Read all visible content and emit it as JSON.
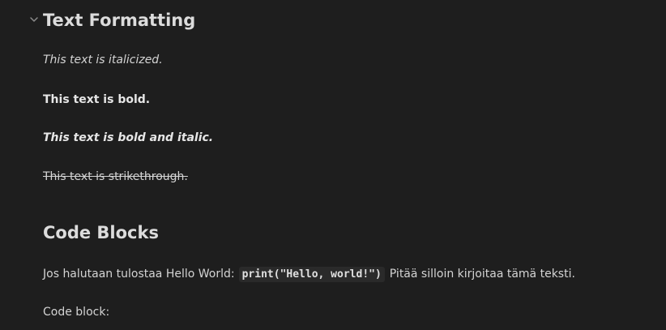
{
  "sections": {
    "text_formatting": {
      "heading": "Text Formatting",
      "fold_icon": "chevron-down-icon",
      "italic": "This text is italicized.",
      "bold": "This text is bold.",
      "bold_italic": "This text is bold and italic.",
      "strikethrough": "This text is strikethrough."
    },
    "code_blocks": {
      "heading": "Code Blocks",
      "line_before": "Jos halutaan tulostaa Hello World:",
      "inline_code": "print(\"Hello, world!\")",
      "line_after": "Pitää silloin kirjoitaa tämä teksti.",
      "code_block_label": "Code block:"
    }
  }
}
